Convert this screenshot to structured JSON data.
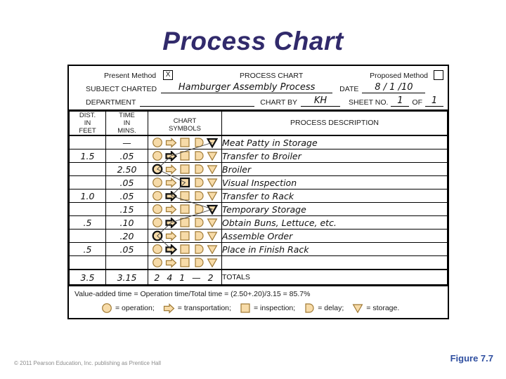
{
  "title": "Process Chart",
  "form": {
    "present_method_label": "Present Method",
    "present_method_mark": "X",
    "form_title": "PROCESS CHART",
    "proposed_method_label": "Proposed Method",
    "proposed_method_mark": "",
    "subject_label": "SUBJECT CHARTED",
    "subject_value": "Hamburger Assembly Process",
    "date_label": "DATE",
    "date_value": "8 / 1 /10",
    "department_label": "DEPARTMENT",
    "department_value": "",
    "chart_by_label": "CHART BY",
    "chart_by_value": "KH",
    "sheet_no_label": "SHEET NO.",
    "sheet_no_value": "1",
    "sheet_of_label": "OF",
    "sheet_of_value": "1"
  },
  "columns": {
    "dist": "DIST.\nIN\nFEET",
    "dist_l1": "DIST.",
    "dist_l2": "IN",
    "dist_l3": "FEET",
    "time_l1": "TIME",
    "time_l2": "IN",
    "time_l3": "MINS.",
    "sym_l1": "CHART",
    "sym_l2": "SYMBOLS",
    "desc": "PROCESS DESCRIPTION"
  },
  "chart_data": {
    "type": "table",
    "title": "Process Chart - Hamburger Assembly Process",
    "headers": [
      "DIST. IN FEET",
      "TIME IN MINS.",
      "CHART SYMBOLS",
      "PROCESS DESCRIPTION"
    ],
    "symbol_types": [
      "operation",
      "transportation",
      "inspection",
      "delay",
      "storage"
    ],
    "rows": [
      {
        "dist": "",
        "time": "—",
        "marked": "storage",
        "desc": "Meat Patty in Storage"
      },
      {
        "dist": "1.5",
        "time": ".05",
        "marked": "transportation",
        "desc": "Transfer to Broiler"
      },
      {
        "dist": "",
        "time": "2.50",
        "marked": "operation",
        "desc": "Broiler"
      },
      {
        "dist": "",
        "time": ".05",
        "marked": "inspection",
        "desc": "Visual Inspection"
      },
      {
        "dist": "1.0",
        "time": ".05",
        "marked": "transportation",
        "desc": "Transfer to Rack"
      },
      {
        "dist": "",
        "time": ".15",
        "marked": "storage",
        "desc": "Temporary Storage"
      },
      {
        "dist": ".5",
        "time": ".10",
        "marked": "transportation",
        "desc": "Obtain Buns, Lettuce, etc."
      },
      {
        "dist": "",
        "time": ".20",
        "marked": "operation",
        "desc": "Assemble Order"
      },
      {
        "dist": ".5",
        "time": ".05",
        "marked": "transportation",
        "desc": "Place in Finish Rack"
      },
      {
        "dist": "",
        "time": "",
        "marked": "none",
        "desc": ""
      }
    ],
    "totals": {
      "dist": "3.5",
      "time": "3.15",
      "symbols": "2  4  1  —  2",
      "label": "TOTALS"
    },
    "value_added_note": "Value-added time = Operation time/Total time = (2.50+.20)/3.15 = 85.7%",
    "legend": [
      {
        "symbol": "operation",
        "text": "= operation;"
      },
      {
        "symbol": "transportation",
        "text": "= transportation;"
      },
      {
        "symbol": "inspection",
        "text": "= inspection;"
      },
      {
        "symbol": "delay",
        "text": "= delay;"
      },
      {
        "symbol": "storage",
        "text": "= storage."
      }
    ]
  },
  "colors": {
    "title": "#312a6b",
    "symbol_fill": "#f7dba8",
    "symbol_stroke": "#a07a35",
    "figure_label": "#2f4fa0"
  },
  "copyright": "© 2011 Pearson Education, Inc. publishing as Prentice Hall",
  "figure_label": "Figure 7.7"
}
